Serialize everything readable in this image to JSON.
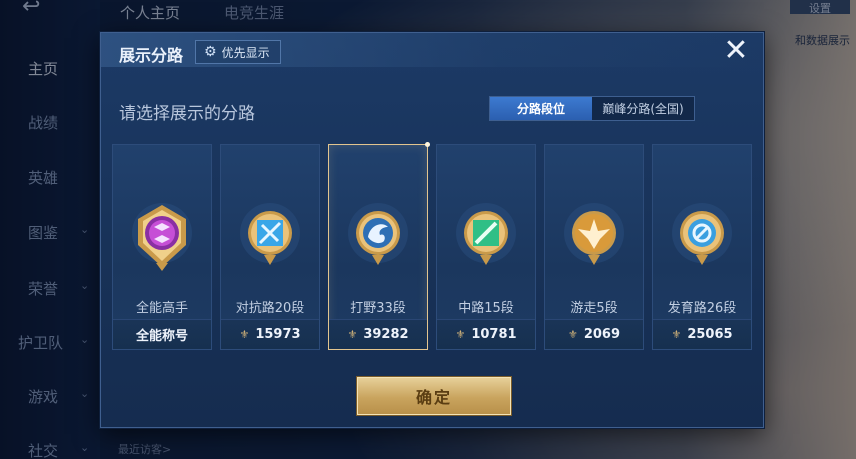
{
  "background": {
    "nav_items": [
      {
        "label": "主页",
        "chevron": ""
      },
      {
        "label": "战绩",
        "chevron": ""
      },
      {
        "label": "英雄",
        "chevron": ""
      },
      {
        "label": "图鉴",
        "chevron": "⌄"
      },
      {
        "label": "荣誉",
        "chevron": "⌄"
      },
      {
        "label": "护卫队",
        "chevron": "⌄"
      },
      {
        "label": "游戏",
        "chevron": "⌄"
      },
      {
        "label": "社交",
        "chevron": "⌄"
      }
    ],
    "top_tabs": [
      "个人主页",
      "电竞生涯"
    ],
    "top_right_button": "设置",
    "right_text": "和数据展示",
    "bottom_text": "最近访客>"
  },
  "modal": {
    "title": "展示分路",
    "priority_label": "优先显示",
    "close_icon": "✕",
    "subtitle": "请选择展示的分路",
    "segments": [
      "分路段位",
      "巅峰分路(全国)"
    ],
    "active_segment": 0,
    "confirm_label": "确定",
    "colors": {
      "accent_gold": "#e2c58f",
      "segment_active": "#3d7ad0"
    }
  },
  "lanes": [
    {
      "name": "全能高手",
      "footer": "全能称号",
      "footer_icon": "",
      "emblem": "all-round-emblem",
      "gem_color": "#c64fd6",
      "selected": false
    },
    {
      "name": "对抗路20段",
      "footer": "15973",
      "footer_icon": "⚜",
      "emblem": "clash-lane-emblem",
      "gem_color": "#3aa6e8",
      "selected": false
    },
    {
      "name": "打野33段",
      "footer": "39282",
      "footer_icon": "⚜",
      "emblem": "jungle-emblem",
      "gem_color": "#2e6fb5",
      "selected": true
    },
    {
      "name": "中路15段",
      "footer": "10781",
      "footer_icon": "⚜",
      "emblem": "mid-lane-emblem",
      "gem_color": "#2fbf86",
      "selected": false
    },
    {
      "name": "游走5段",
      "footer": "2069",
      "footer_icon": "⚜",
      "emblem": "roam-emblem",
      "gem_color": "#d99a3a",
      "selected": false
    },
    {
      "name": "发育路26段",
      "footer": "25065",
      "footer_icon": "⚜",
      "emblem": "farm-lane-emblem",
      "gem_color": "#3a9fe0",
      "selected": false
    }
  ]
}
